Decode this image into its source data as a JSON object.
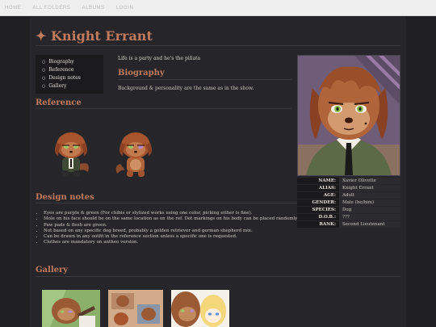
{
  "nav": [
    {
      "label": "HOME"
    },
    {
      "label": "ALL FOLDERS"
    },
    {
      "label": "ALBUMS"
    },
    {
      "label": "LOGIN"
    }
  ],
  "page": {
    "title": "Knight Errant",
    "title_icon": "sparkle-icon",
    "intro": "Life is a party and he's the piñata"
  },
  "toc": [
    "Biography",
    "Reference",
    "Design notes",
    "Gallery"
  ],
  "biography": {
    "heading": "Biography",
    "text": "Background & personality are the same as in the show."
  },
  "reference": {
    "heading": "Reference"
  },
  "design_notes": {
    "heading": "Design notes",
    "items": [
      "Eyes are purple & green (For chibis or stylized works using one color, picking either is fine).",
      "Mole on his face should be on the same location as on the ref. Dot markings on his body can be placed randomly.",
      "Paw pads & flesh are green.",
      "Not based on any specific dog breed, probably a golden retriever and german shepherd mix.",
      "Can be drawn in any outfit in the reference section unless a specific one is requested.",
      "Clothes are mandatory on antheo version."
    ]
  },
  "gallery": {
    "heading": "Gallery"
  },
  "info": [
    {
      "key": "NAME:",
      "value": "Xavier Olivette"
    },
    {
      "key": "ALIAS:",
      "value": "Knight Errant"
    },
    {
      "key": "AGE:",
      "value": "Adult"
    },
    {
      "key": "GENDER:",
      "value": "Male (he/him)"
    },
    {
      "key": "SPECIES:",
      "value": "Dog"
    },
    {
      "key": "D.O.B.:",
      "value": "???"
    },
    {
      "key": "RANK:",
      "value": "Second Lieutenant"
    }
  ],
  "colors": {
    "accent": "#c07a5c",
    "background": "#202022",
    "panel": "#26262a"
  }
}
